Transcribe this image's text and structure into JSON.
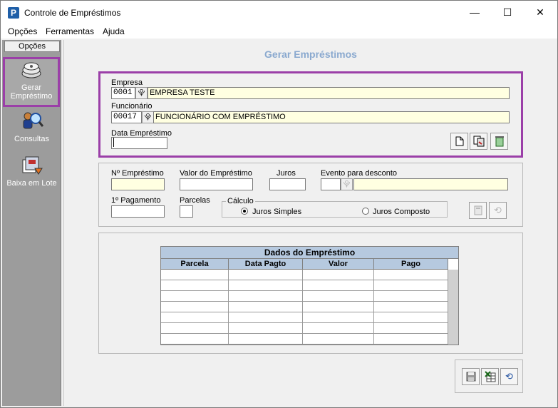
{
  "window": {
    "title": "Controle de Empréstimos",
    "app_icon": "P",
    "minimize": "—",
    "maximize": "☐",
    "close": "✕"
  },
  "menu": {
    "items": [
      "Opções",
      "Ferramentas",
      "Ajuda"
    ]
  },
  "sidebar": {
    "header": "Opções",
    "items": [
      {
        "label": "Gerar Empréstimo",
        "icon": "disks-icon",
        "selected": true
      },
      {
        "label": "Consultas",
        "icon": "magnifier-people-icon",
        "selected": false
      },
      {
        "label": "Baixa em Lote",
        "icon": "batch-file-icon",
        "selected": false
      }
    ]
  },
  "form": {
    "title": "Gerar Empréstimos",
    "empresa": {
      "label": "Empresa",
      "code": "0001",
      "name": "EMPRESA TESTE"
    },
    "funcionario": {
      "label": "Funcionário",
      "code": "00017",
      "name": "FUNCIONÁRIO COM EMPRÉSTIMO"
    },
    "data_emprestimo": {
      "label": "Data Empréstimo",
      "value": ""
    },
    "lookup_glyph": "⯓",
    "toolbar": {
      "new_icon": "new-document-icon",
      "copy_icon": "copy-icon",
      "delete_icon": "recycle-bin-icon"
    }
  },
  "details": {
    "numero_label": "Nº Empréstimo",
    "valor_label": "Valor do Empréstimo",
    "juros_label": "Juros",
    "evento_label": "Evento para desconto",
    "primeiro_pagamento_label": "1º Pagamento",
    "parcelas_label": "Parcelas",
    "calculo": {
      "legend": "Cálculo",
      "options": [
        {
          "label": "Juros Simples",
          "selected": true
        },
        {
          "label": "Juros Composto",
          "selected": false
        }
      ]
    }
  },
  "grid": {
    "title": "Dados do Empréstimo",
    "columns": [
      "Parcela",
      "Data Pagto",
      "Valor",
      "Pago"
    ],
    "rows": [
      [
        "",
        "",
        "",
        ""
      ],
      [
        "",
        "",
        "",
        ""
      ],
      [
        "",
        "",
        "",
        ""
      ],
      [
        "",
        "",
        "",
        ""
      ],
      [
        "",
        "",
        "",
        ""
      ],
      [
        "",
        "",
        "",
        ""
      ],
      [
        "",
        "",
        "",
        ""
      ]
    ]
  },
  "colors": {
    "highlight": "#9b3fa8",
    "required_field": "#ffffe1",
    "title_blue": "#8aa9cf",
    "grid_header": "#b6c9df"
  }
}
